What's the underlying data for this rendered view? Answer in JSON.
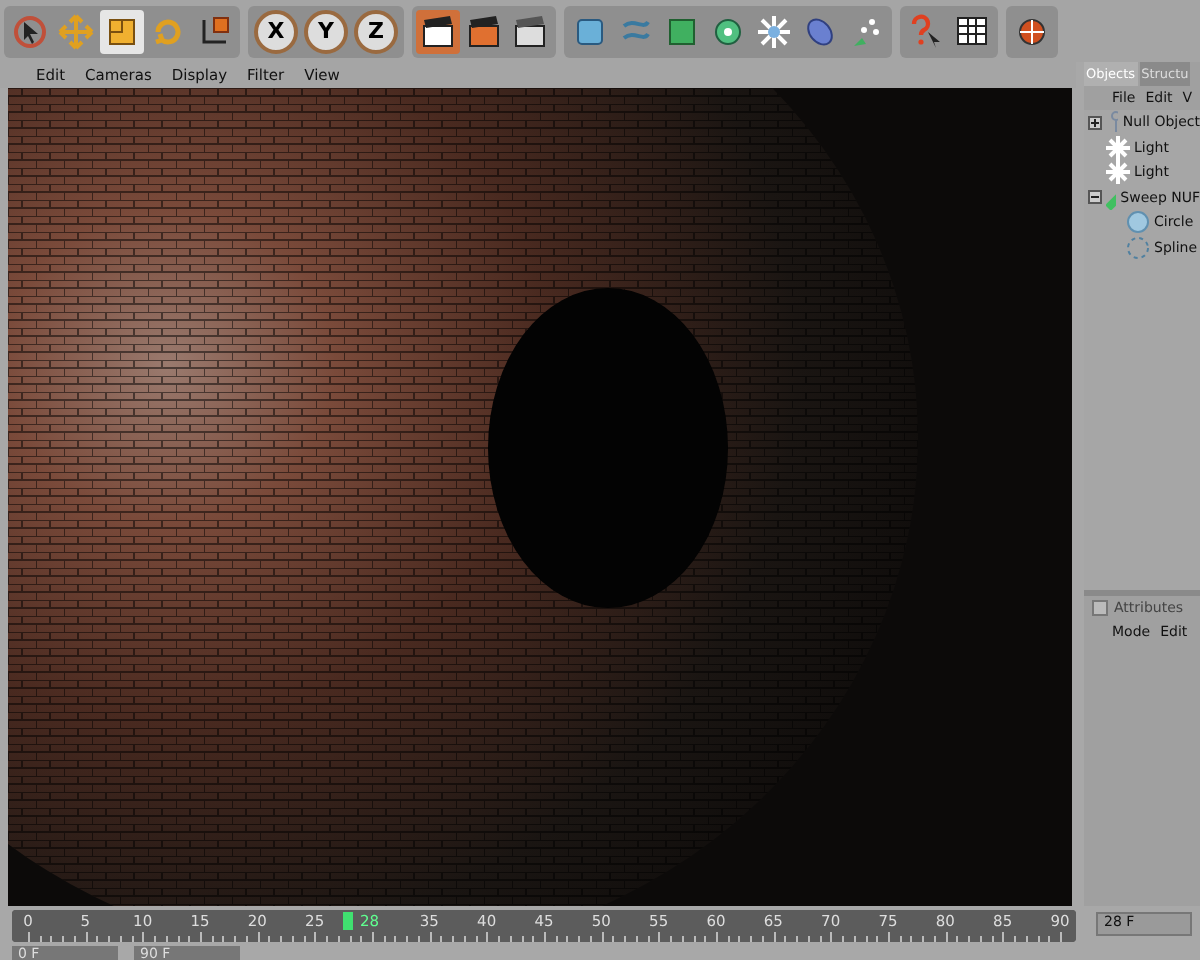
{
  "toolbar": {
    "tools": [
      {
        "selected": false
      },
      {
        "selected": false
      },
      {
        "selected": true
      },
      {
        "selected": false
      },
      {
        "selected": false
      }
    ],
    "axes": [
      {
        "label": "X",
        "selected": false
      },
      {
        "label": "Y",
        "selected": false
      },
      {
        "label": "Z",
        "selected": false
      }
    ],
    "render": [
      {
        "selected": true
      },
      {
        "selected": false
      },
      {
        "selected": false
      }
    ]
  },
  "viewport_menu": [
    "Edit",
    "Cameras",
    "Display",
    "Filter",
    "View"
  ],
  "object_manager": {
    "tabs": [
      {
        "label": "Objects",
        "selected": true
      },
      {
        "label": "Structu",
        "selected": false
      }
    ],
    "menu": [
      "File",
      "Edit",
      "V"
    ],
    "objects": [
      {
        "name": "Null Object",
        "kind": "null",
        "expanded": false
      },
      {
        "name": "Light",
        "kind": "light"
      },
      {
        "name": "Light",
        "kind": "light"
      },
      {
        "name": "Sweep NUF",
        "kind": "sweep",
        "expanded": true,
        "children": [
          {
            "name": "Circle",
            "kind": "circle"
          },
          {
            "name": "Spline",
            "kind": "spline"
          }
        ]
      }
    ]
  },
  "attributes": {
    "title": "Attributes",
    "menu": [
      "Mode",
      "Edit"
    ]
  },
  "timeline": {
    "ticks_before": [
      "0",
      "5",
      "10",
      "15",
      "20",
      "25"
    ],
    "ticks_after": [
      "35",
      "40",
      "45",
      "50",
      "55",
      "60",
      "65",
      "70",
      "75",
      "80",
      "85",
      "90"
    ],
    "current": "28",
    "level": 0.311,
    "frame_field": "28 F",
    "start_field": "0 F",
    "end_field": "90 F"
  }
}
